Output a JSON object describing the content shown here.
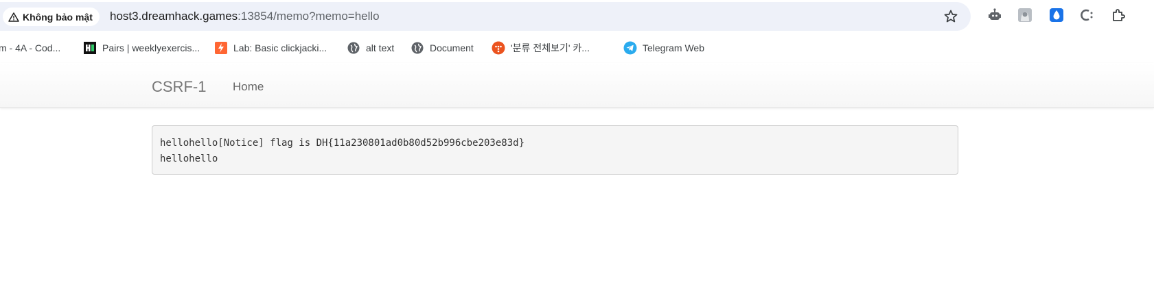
{
  "browser": {
    "security_label": "Không bảo mật",
    "url_host": "host3.dreamhack.games",
    "url_rest": ":13854/memo?memo=hello",
    "bookmarks": [
      {
        "label": "m - 4A - Cod...",
        "icon": "none"
      },
      {
        "label": "Pairs | weeklyexercis...",
        "icon": "hackerrank-icon"
      },
      {
        "label": "Lab: Basic clickjacki...",
        "icon": "portswigger-icon"
      },
      {
        "label": "alt text",
        "icon": "globe-icon"
      },
      {
        "label": "Document",
        "icon": "globe-icon"
      },
      {
        "label": "'분류 전체보기' 카...",
        "icon": "tistory-icon"
      },
      {
        "label": "Telegram Web",
        "icon": "telegram-icon"
      }
    ]
  },
  "app": {
    "brand": "CSRF-1",
    "nav_home": "Home",
    "memo_lines": [
      "hellohello[Notice] flag is DH{11a230801ad0b80d52b996cbe203e83d}",
      "hellohello"
    ]
  },
  "colors": {
    "omnibox_bg": "#eef1f9",
    "telegram": "#2aabee",
    "tistory": "#eb531f",
    "portswigger": "#ff6633"
  }
}
